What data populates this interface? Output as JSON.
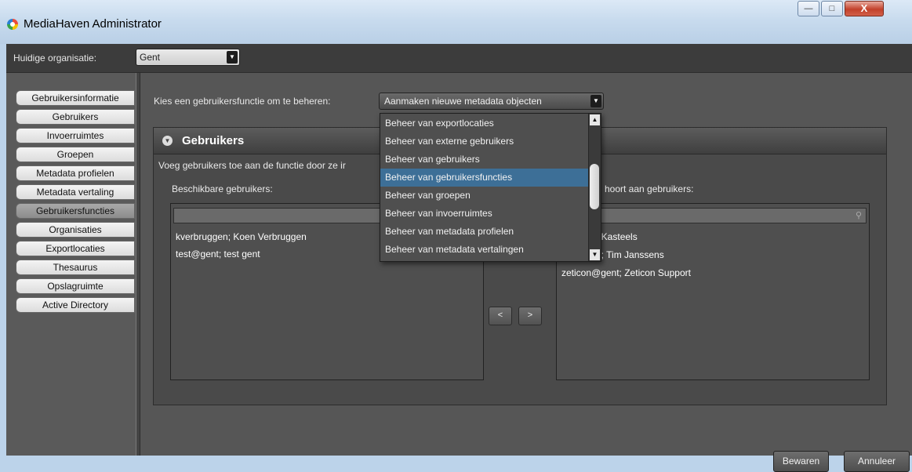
{
  "window": {
    "title": "MediaHaven Administrator",
    "min_label": "—",
    "max_label": "□",
    "close_label": "X"
  },
  "org": {
    "label": "Huidige organisatie:",
    "value": "Gent"
  },
  "sidebar": {
    "items": [
      {
        "label": "Gebruikersinformatie"
      },
      {
        "label": "Gebruikers"
      },
      {
        "label": "Invoerruimtes"
      },
      {
        "label": "Groepen"
      },
      {
        "label": "Metadata profielen"
      },
      {
        "label": "Metadata vertaling"
      },
      {
        "label": "Gebruikersfuncties"
      },
      {
        "label": "Organisaties"
      },
      {
        "label": "Exportlocaties"
      },
      {
        "label": "Thesaurus"
      },
      {
        "label": "Opslagruimte"
      },
      {
        "label": "Active Directory"
      }
    ],
    "active": "Gebruikersfuncties"
  },
  "main": {
    "choose_label": "Kies een gebruikersfunctie om te beheren:",
    "selected_function": "Aanmaken nieuwe metadata objecten",
    "panel": {
      "title": "Gebruikers",
      "hint": "Voeg gebruikers toe aan de functie door ze ir",
      "available_label": "Beschikbare gebruikers:",
      "assigned_label": "hoort aan gebruikers:",
      "available_users": [
        "kverbruggen; Koen Verbruggen",
        "test@gent; test gent"
      ],
      "assigned_users": [
        "ls; Mieke Kasteels",
        "tjanssens; Tim Janssens",
        "zeticon@gent; Zeticon Support"
      ],
      "move_left": "<",
      "move_right": ">"
    },
    "save_label": "Bewaren",
    "cancel_label": "Annuleer"
  },
  "dropdown": {
    "options": [
      "Beheer van exportlocaties",
      "Beheer van externe gebruikers",
      "Beheer van gebruikers",
      "Beheer van gebruikersfuncties",
      "Beheer van groepen",
      "Beheer van invoerruimtes",
      "Beheer van metadata profielen",
      "Beheer van metadata vertalingen"
    ],
    "highlighted": "Beheer van gebruikersfuncties"
  },
  "colors": {
    "highlight": "#3d6f97",
    "background": "#565656"
  }
}
